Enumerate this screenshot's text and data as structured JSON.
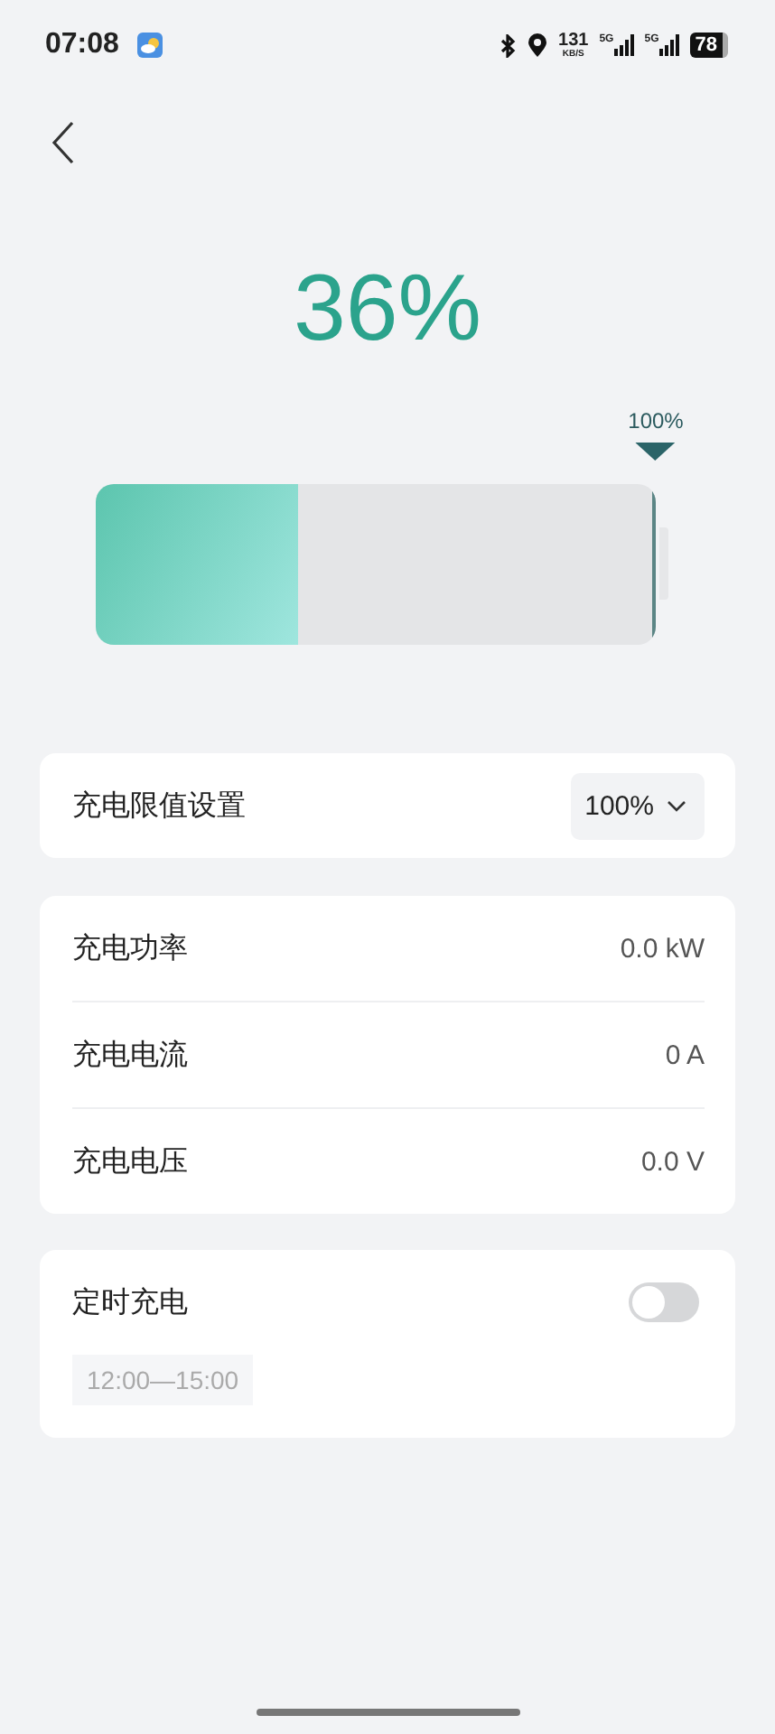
{
  "status_bar": {
    "time": "07:08",
    "net_speed": "131",
    "net_unit": "KB/S",
    "sim1": "5G",
    "sim2": "5G",
    "battery": "78"
  },
  "charge": {
    "percent": "36%",
    "level": 0.36,
    "limit_label": "100%"
  },
  "limit_setting": {
    "label": "充电限值设置",
    "value": "100%"
  },
  "stats": [
    {
      "label": "充电功率",
      "value": "0.0 kW"
    },
    {
      "label": "充电电流",
      "value": "0 A"
    },
    {
      "label": "充电电压",
      "value": "0.0 V"
    }
  ],
  "schedule": {
    "label": "定时充电",
    "on": false,
    "time": "12:00—15:00"
  }
}
